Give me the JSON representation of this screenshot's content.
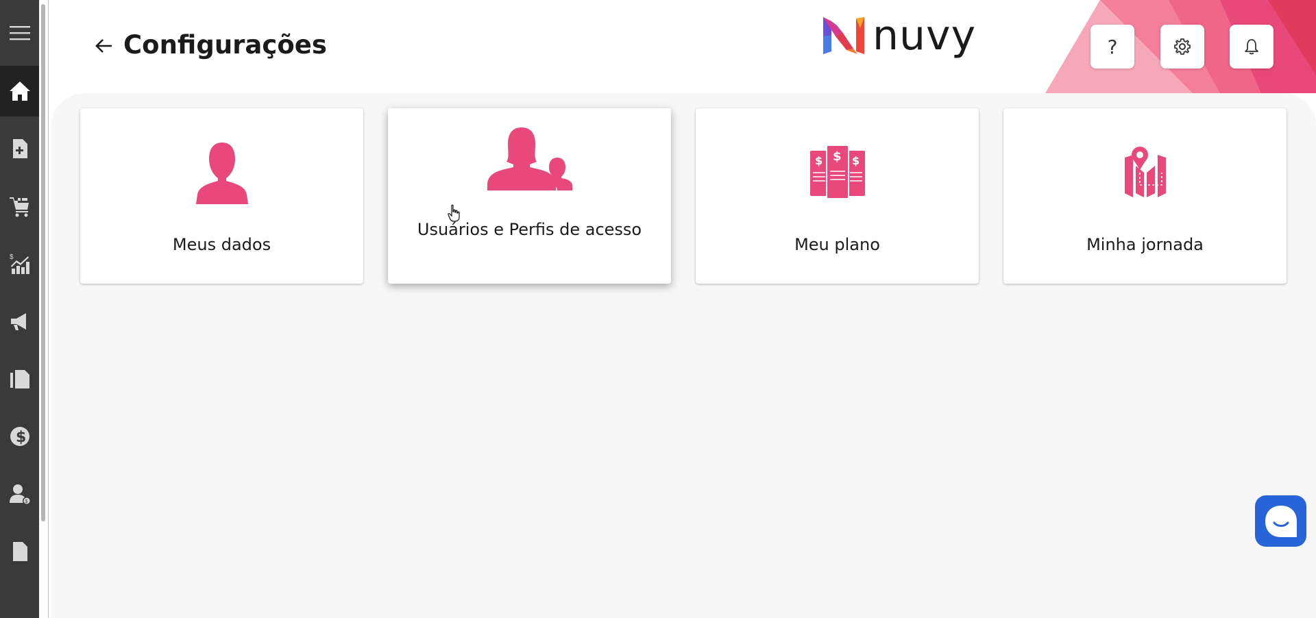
{
  "header": {
    "title": "Configurações",
    "logo_text": "nuvy",
    "back_label": "Voltar",
    "help_label": "?"
  },
  "sidebar": {
    "items": [
      {
        "name": "menu",
        "icon": "hamburger-menu-icon"
      },
      {
        "name": "home",
        "icon": "home-icon",
        "active": true
      },
      {
        "name": "add-document",
        "icon": "add-document-icon"
      },
      {
        "name": "shopping-cart",
        "icon": "gift-cart-icon"
      },
      {
        "name": "reports",
        "icon": "chart-dollar-icon"
      },
      {
        "name": "campaigns",
        "icon": "megaphone-icon"
      },
      {
        "name": "catalog",
        "icon": "documents-icon"
      },
      {
        "name": "finance",
        "icon": "dollar-coin-icon"
      },
      {
        "name": "customers",
        "icon": "user-dollar-icon"
      },
      {
        "name": "files",
        "icon": "file-icon"
      }
    ]
  },
  "cards": [
    {
      "label": "Meus dados",
      "icon": "single-user-icon"
    },
    {
      "label": "Usuários e Perfis de acesso",
      "icon": "users-group-icon"
    },
    {
      "label": "Meu plano",
      "icon": "price-plan-icon"
    },
    {
      "label": "Minha jornada",
      "icon": "map-pin-icon"
    }
  ],
  "colors": {
    "accent": "#e8497a",
    "sidebar": "#3a3a3a",
    "sidebar_active": "#222222",
    "chat": "#2864d9",
    "background": "#f7f7f7"
  }
}
